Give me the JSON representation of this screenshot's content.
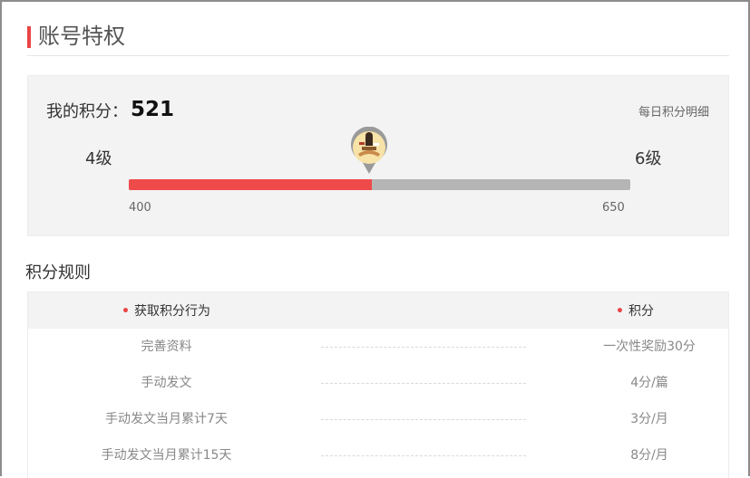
{
  "section": {
    "title": "账号特权"
  },
  "score": {
    "label": "我的积分：",
    "value": "521",
    "detail_link": "每日积分明细",
    "level_current": "4级",
    "level_next": "6级",
    "range_min": "400",
    "range_max": "650",
    "progress_fraction": 0.484,
    "avatar_icon": "avatar-marker-icon"
  },
  "rules": {
    "title": "积分规则",
    "header_action": "获取积分行为",
    "header_points": "积分",
    "rows": [
      {
        "action": "完善资料",
        "points": "一次性奖励30分"
      },
      {
        "action": "手动发文",
        "points": "4分/篇"
      },
      {
        "action": "手动发文当月累计7天",
        "points": "3分/月"
      },
      {
        "action": "手动发文当月累计15天",
        "points": "8分/月"
      }
    ]
  },
  "colors": {
    "accent": "#e94545",
    "progress_fill": "#ee4a4a",
    "progress_track": "#b5b5b5",
    "panel_bg": "#f3f3f3"
  }
}
